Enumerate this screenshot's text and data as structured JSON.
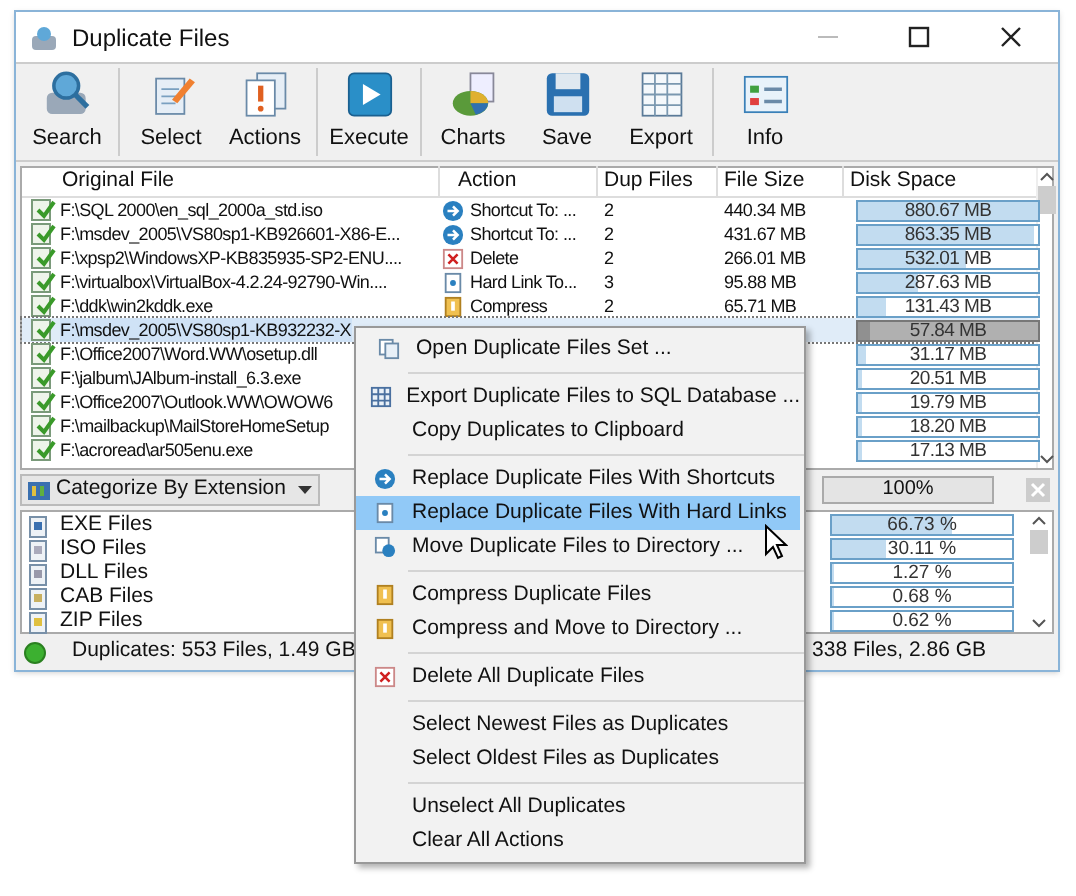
{
  "window": {
    "title": "Duplicate Files"
  },
  "toolbar": [
    [
      {
        "label": "Search",
        "kind": "search"
      }
    ],
    [
      {
        "label": "Select",
        "kind": "select"
      },
      {
        "label": "Actions",
        "kind": "actions"
      }
    ],
    [
      {
        "label": "Execute",
        "kind": "execute"
      }
    ],
    [
      {
        "label": "Charts",
        "kind": "charts"
      },
      {
        "label": "Save",
        "kind": "save"
      },
      {
        "label": "Export",
        "kind": "export"
      }
    ],
    [
      {
        "label": "Info",
        "kind": "info"
      }
    ]
  ],
  "table": {
    "columns": [
      "Original File",
      "Action",
      "Dup Files",
      "File Size",
      "Disk Space"
    ],
    "rows": [
      {
        "checked": true,
        "selected": false,
        "file": "F:\\SQL 2000\\en_sql_2000a_std.iso",
        "kind": "shortcut",
        "action": "Shortcut To: ...",
        "dup": "2",
        "size": "440.34 MB",
        "disk": "880.67 MB",
        "level": 1
      },
      {
        "checked": true,
        "selected": false,
        "file": "F:\\msdev_2005\\VS80sp1-KB926601-X86-E...",
        "kind": "shortcut",
        "action": "Shortcut To: ...",
        "dup": "2",
        "size": "431.67 MB",
        "disk": "863.35 MB",
        "level": 0.98
      },
      {
        "checked": true,
        "selected": false,
        "file": "F:\\xpsp2\\WindowsXP-KB835935-SP2-ENU....",
        "kind": "delete",
        "action": "Delete",
        "dup": "2",
        "size": "266.01 MB",
        "disk": "532.01 MB",
        "level": 0.6
      },
      {
        "checked": true,
        "selected": false,
        "file": "F:\\virtualbox\\VirtualBox-4.2.24-92790-Win....",
        "kind": "hardlink",
        "action": "Hard Link To...",
        "dup": "3",
        "size": "95.88 MB",
        "disk": "287.63 MB",
        "level": 0.33
      },
      {
        "checked": true,
        "selected": false,
        "file": "F:\\ddk\\win2kddk.exe",
        "kind": "compress",
        "action": "Compress",
        "dup": "2",
        "size": "65.71 MB",
        "disk": "131.43 MB",
        "level": 0.15
      },
      {
        "checked": true,
        "selected": true,
        "file": "F:\\msdev_2005\\VS80sp1-KB932232-X",
        "disk": "57.84 MB",
        "level": 0.07
      },
      {
        "checked": true,
        "selected": false,
        "file": "F:\\Office2007\\Word.WW\\osetup.dll",
        "disk": "31.17 MB",
        "level": 0.04
      },
      {
        "checked": true,
        "selected": false,
        "file": "F:\\jalbum\\JAlbum-install_6.3.exe",
        "disk": "20.51 MB",
        "level": 0.02
      },
      {
        "checked": true,
        "selected": false,
        "file": "F:\\Office2007\\Outlook.WW\\OWOW6",
        "disk": "19.79 MB",
        "level": 0.02
      },
      {
        "checked": true,
        "selected": false,
        "file": "F:\\mailbackup\\MailStoreHomeSetup",
        "disk": "18.20 MB",
        "level": 0.02
      },
      {
        "checked": true,
        "selected": false,
        "file": "F:\\acroread\\ar505enu.exe",
        "disk": "17.13 MB",
        "level": 0.02
      }
    ]
  },
  "category_select": {
    "value": "Categorize By Extension"
  },
  "total_progress": {
    "reading": "100%",
    "level": 1
  },
  "categories": [
    {
      "name": "EXE Files",
      "reading": "66.73 %",
      "level": 0.667
    },
    {
      "name": "ISO Files",
      "reading": "30.11 %",
      "level": 0.301
    },
    {
      "name": "DLL Files",
      "reading": "1.27 %",
      "level": 0.013
    },
    {
      "name": "CAB Files",
      "reading": "0.68 %",
      "level": 0.007
    },
    {
      "name": "ZIP Files",
      "reading": "0.62 %",
      "level": 0.006
    }
  ],
  "status_bar": {
    "left": "Duplicates: 553 Files, 1.49 GB",
    "right": "338 Files, 2.86 GB"
  },
  "context_menu": [
    [
      {
        "label": "Open Duplicate Files Set ...",
        "kind": "open",
        "selected": false
      }
    ],
    [
      {
        "label": "Export Duplicate Files to SQL Database ...",
        "kind": "grid",
        "selected": false
      },
      {
        "label": "Copy Duplicates to Clipboard",
        "kind": "plain",
        "selected": false
      }
    ],
    [
      {
        "label": "Replace Duplicate Files With Shortcuts",
        "kind": "shortcut",
        "selected": false
      },
      {
        "label": "Replace Duplicate Files With Hard Links",
        "kind": "hardlink",
        "selected": true
      },
      {
        "label": "Move Duplicate Files to Directory ...",
        "kind": "move",
        "selected": false
      }
    ],
    [
      {
        "label": "Compress Duplicate Files",
        "kind": "compress",
        "selected": false
      },
      {
        "label": "Compress and Move to Directory ...",
        "kind": "compress",
        "selected": false
      }
    ],
    [
      {
        "label": "Delete All Duplicate Files",
        "kind": "delete",
        "selected": false
      }
    ],
    [
      {
        "label": "Select Newest Files as Duplicates",
        "kind": "plain",
        "selected": false
      },
      {
        "label": "Select Oldest Files as Duplicates",
        "kind": "plain",
        "selected": false
      }
    ],
    [
      {
        "label": "Unselect All Duplicates",
        "kind": "plain",
        "selected": false
      },
      {
        "label": "Clear All Actions",
        "kind": "plain",
        "selected": false
      }
    ]
  ]
}
